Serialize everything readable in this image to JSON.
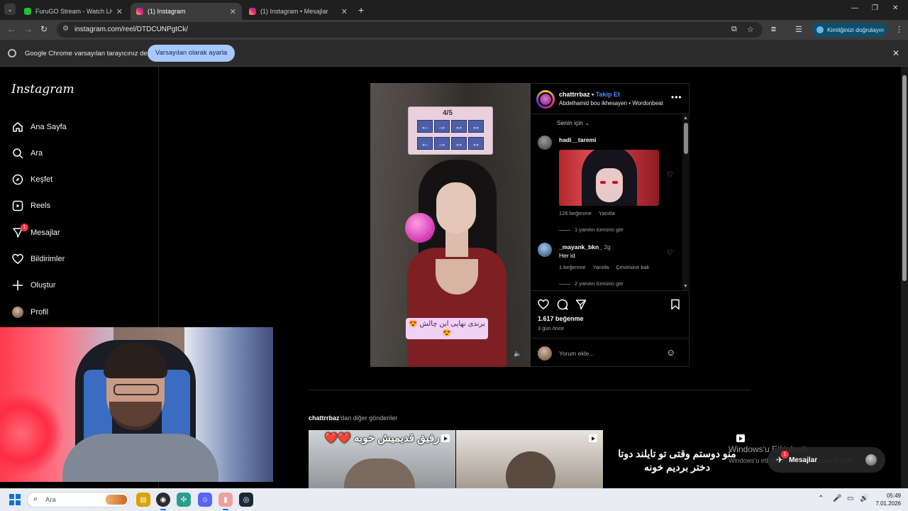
{
  "browser": {
    "tabs": [
      {
        "title": "FuruGO Stream - Watch Live on",
        "favicon_color": "#1fbf3f",
        "active": false
      },
      {
        "title": "(1) Instagram",
        "favicon_color": "#e1306c",
        "active": true
      },
      {
        "title": "(1) Instagram • Mesajlar",
        "favicon_color": "#e1306c",
        "active": false
      }
    ],
    "url": "instagram.com/reel/DTDCUNPgtCk/",
    "verify_label": "Kimliğinizi doğrulayın",
    "infobar": {
      "message": "Google Chrome varsayılan tarayıcınız değil",
      "button": "Varsayılan olarak ayarla"
    }
  },
  "sidebar": {
    "logo": "Instagram",
    "items": [
      {
        "label": "Ana Sayfa",
        "icon": "home-icon"
      },
      {
        "label": "Ara",
        "icon": "search-icon"
      },
      {
        "label": "Keşfet",
        "icon": "compass-icon"
      },
      {
        "label": "Reels",
        "icon": "reels-icon"
      },
      {
        "label": "Mesajlar",
        "icon": "messenger-icon",
        "badge": "1"
      },
      {
        "label": "Bildirimler",
        "icon": "heart-icon"
      },
      {
        "label": "Oluştur",
        "icon": "plus-icon"
      },
      {
        "label": "Profil",
        "icon": "avatar"
      }
    ]
  },
  "reel": {
    "game_score": "4/5",
    "caption": "برندی نهایی این چالش 😍😍"
  },
  "post": {
    "username": "chattrrbaz",
    "separator": "•",
    "follow": "Takip Et",
    "audio": "Abdelhamid bou ikhesayen • Wordonbeat",
    "sort": "Senin için",
    "comments": [
      {
        "user": "hadi__taremi",
        "time": "",
        "text": "",
        "likes": "126 beğenme",
        "reply": "Yanıtla",
        "translate": "",
        "view_replies": "1 yanıtın tümünü gör"
      },
      {
        "user": "_mayank_bkn_",
        "time": "2g",
        "text": "Her id",
        "likes": "1 beğenme",
        "reply": "Yanıtla",
        "translate": "Çevirisine bak",
        "view_replies": "2 yanıtın tümünü gör"
      }
    ],
    "like_count": "1.617 beğenme",
    "time_ago": "3 gün önce",
    "comment_placeholder": "Yorum ekle..."
  },
  "more_posts": {
    "user": "chattrrbaz",
    "suffix": "'dan diğer gönderiler",
    "thumbs": [
      {
        "text": "رفیق قدیمیش خوبه ❤️❤️"
      },
      {
        "text": ""
      },
      {
        "text": "منو دوستم وقتی تو تایلند دوتا دختر بردیم خونه"
      }
    ]
  },
  "watermark": {
    "line1": "Windows'u Etkinleştir",
    "line2": "Windows'u etkinleştirmek için Ayarlar'a gidin."
  },
  "messages_pill": {
    "label": "Mesajlar",
    "badge": "1"
  },
  "taskbar": {
    "search_placeholder": "Ara",
    "time": "05:49",
    "date": "7.01.2026"
  }
}
